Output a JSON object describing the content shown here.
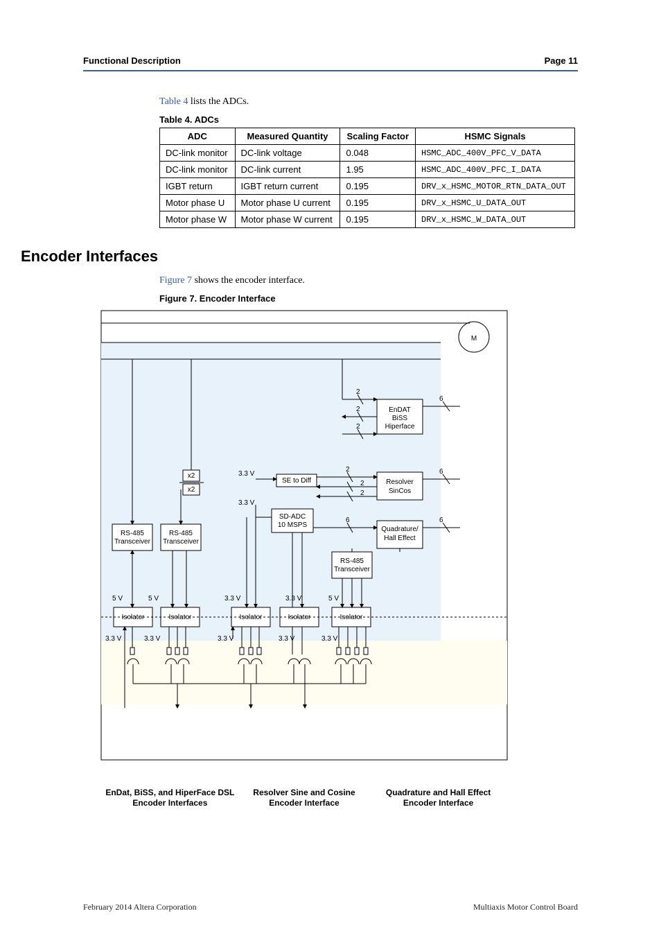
{
  "header": {
    "left": "Functional Description",
    "right": "Page 11"
  },
  "intro": {
    "link": "Table 4",
    "rest": " lists the ADCs."
  },
  "table4": {
    "caption": "Table 4.  ADCs",
    "headers": [
      "ADC",
      "Measured Quantity",
      "Scaling Factor",
      "HSMC Signals"
    ],
    "rows": [
      {
        "adc": "DC-link monitor",
        "mq": "DC-link voltage",
        "sf": "0.048",
        "sig": "HSMC_ADC_400V_PFC_V_DATA"
      },
      {
        "adc": "DC-link monitor",
        "mq": "DC-link current",
        "sf": "1.95",
        "sig": "HSMC_ADC_400V_PFC_I_DATA"
      },
      {
        "adc": "IGBT return",
        "mq": "IGBT return current",
        "sf": "0.195",
        "sig": "DRV_x_HSMC_MOTOR_RTN_DATA_OUT"
      },
      {
        "adc": "Motor phase U",
        "mq": "Motor phase U current",
        "sf": "0.195",
        "sig": "DRV_x_HSMC_U_DATA_OUT"
      },
      {
        "adc": "Motor phase W",
        "mq": "Motor phase W current",
        "sf": "0.195",
        "sig": "DRV_x_HSMC_W_DATA_OUT"
      }
    ]
  },
  "section": {
    "title": "Encoder Interfaces"
  },
  "section_intro": {
    "link": "Figure 7",
    "rest": " shows the encoder interface."
  },
  "figure7": {
    "caption": "Figure 7.  Encoder Interface",
    "motor": "M",
    "bus_counts": {
      "upper1": "2",
      "upper2": "2",
      "upper3": "2",
      "se2diff_a": "2",
      "se2diff_b": "2",
      "se2diff_c": "2",
      "sdadc": "6",
      "conn1": "6",
      "conn2": "6",
      "conn3": "6"
    },
    "blocks": {
      "x2_top": "x2",
      "x2_bot": "x2",
      "se_to_diff": "SE to Diff",
      "sd_adc_l1": "SD-ADC",
      "sd_adc_l2": "10 MSPS",
      "rs485_1": "RS-485\nTransceiver",
      "rs485_2": "RS-485\nTransceiver",
      "rs485_3": "RS-485\nTransceiver",
      "endat_l1": "EnDAT",
      "endat_l2": "BiSS",
      "endat_l3": "Hiperface",
      "resolver_l1": "Resolver",
      "resolver_l2": "SinCos",
      "quad_l1": "Quadrature/",
      "quad_l2": "Hall Effect",
      "isolator": "Isolator"
    },
    "voltages": {
      "v3_3": "3.3 V",
      "v5": "5 V"
    },
    "bottom_labels": {
      "l1": "EnDat, BiSS, and HiperFace DSL Encoder Interfaces",
      "l2": "Resolver Sine and Cosine Encoder Interface",
      "l3": "Quadrature and Hall Effect Encoder Interface"
    }
  },
  "footer": {
    "left": "February 2014   Altera Corporation",
    "right": "Multiaxis Motor Control Board"
  }
}
